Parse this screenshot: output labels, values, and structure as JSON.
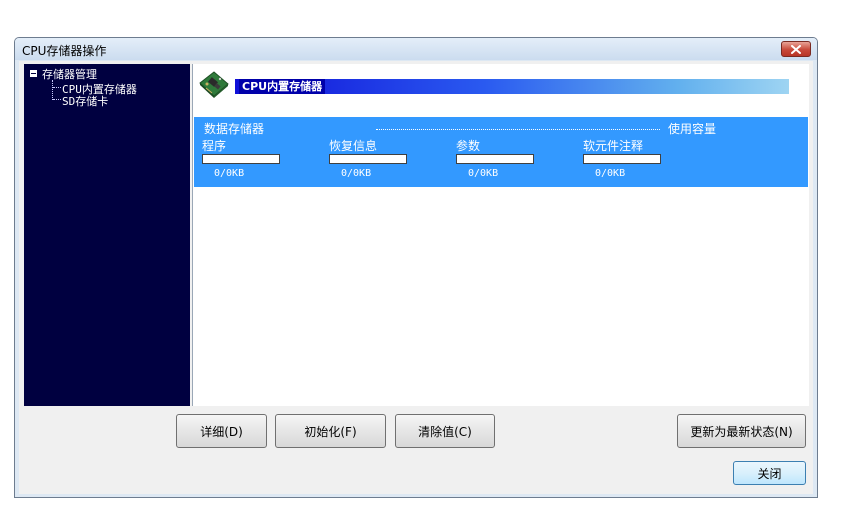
{
  "window": {
    "title": "CPU存储器操作"
  },
  "tree": {
    "root": "存储器管理",
    "children": [
      "CPU内置存储器",
      "SD存储卡"
    ]
  },
  "main": {
    "header": "CPU内置存储器",
    "panel_title": "数据存储器",
    "usage_label": "使用容量",
    "items": [
      {
        "label": "程序",
        "value": "0/0KB",
        "fill": 0
      },
      {
        "label": "恢复信息",
        "value": "0/0KB",
        "fill": 0
      },
      {
        "label": "参数",
        "value": "0/0KB",
        "fill": 0
      },
      {
        "label": "软元件注释",
        "value": "0/0KB",
        "fill": 0
      }
    ]
  },
  "buttons": {
    "details": "详细(D)",
    "initialize": "初始化(F)",
    "clear": "清除值(C)",
    "refresh": "更新为最新状态(N)",
    "close": "关闭"
  },
  "colors": {
    "tree_bg": "#000040",
    "panel_bg": "#3399ff",
    "header_start": "#1010d8",
    "header_end": "#9ed4f2",
    "close_red": "#c8493a"
  }
}
